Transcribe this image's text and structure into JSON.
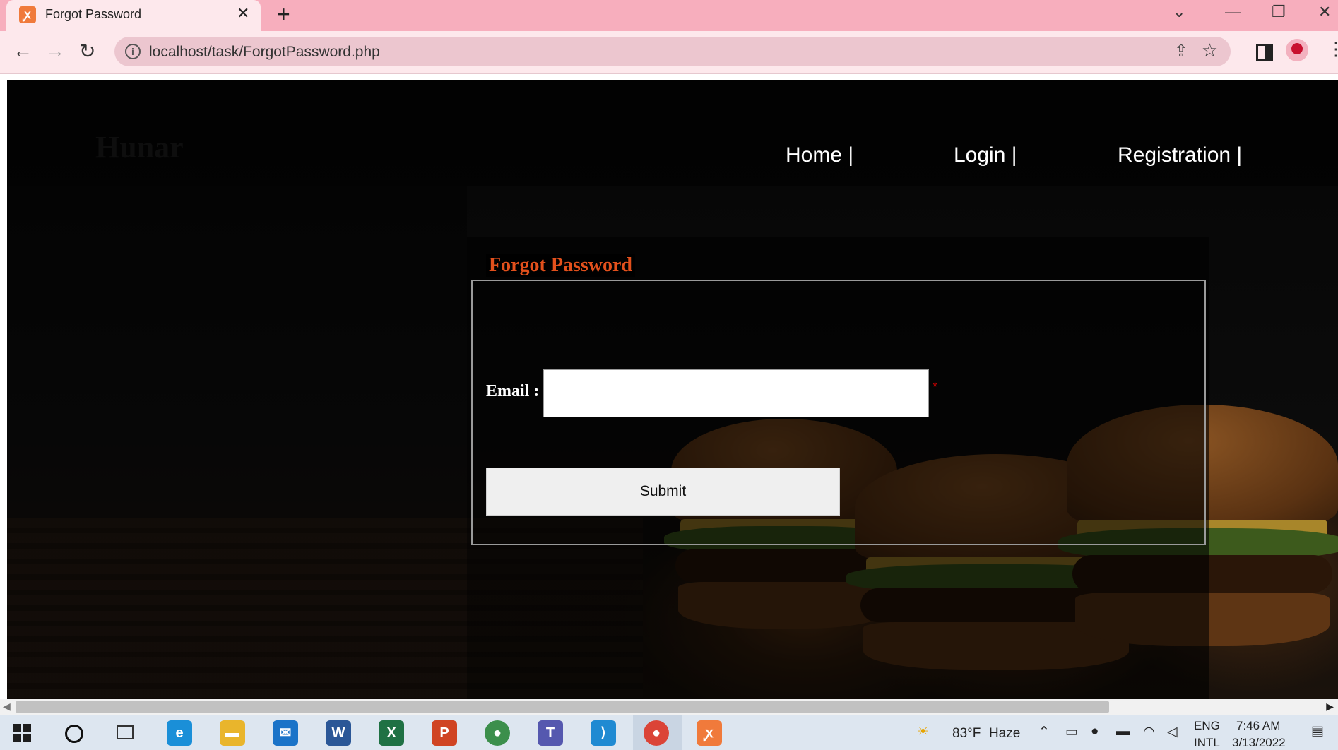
{
  "browser": {
    "tab_title": "Forgot Password",
    "tab_close": "✕",
    "new_tab": "+",
    "url": "localhost/task/ForgotPassword.php",
    "window_controls": {
      "minimize": "—",
      "restore": "❐",
      "close": "✕",
      "tab_search": "⌄"
    }
  },
  "site": {
    "brand": "Hunar",
    "nav": [
      {
        "label": "Home |"
      },
      {
        "label": "Login |"
      },
      {
        "label": "Registration |"
      }
    ]
  },
  "form": {
    "legend": "Forgot Password",
    "email_label": "Email :",
    "email_value": "",
    "required_mark": "*",
    "submit_label": "Submit"
  },
  "taskbar": {
    "apps": [
      {
        "name": "edge",
        "glyph": "e",
        "color": "#1a8fd8"
      },
      {
        "name": "file-explorer",
        "glyph": "▬",
        "color": "#e9b52c"
      },
      {
        "name": "mail",
        "glyph": "✉",
        "color": "#1a73c8"
      },
      {
        "name": "word",
        "glyph": "W",
        "color": "#2b5797"
      },
      {
        "name": "excel",
        "glyph": "X",
        "color": "#1f7144"
      },
      {
        "name": "powerpoint",
        "glyph": "P",
        "color": "#d04423"
      },
      {
        "name": "chrome",
        "glyph": "●",
        "color": "#3c8f4c"
      },
      {
        "name": "teams",
        "glyph": "T",
        "color": "#5558af"
      },
      {
        "name": "vscode",
        "glyph": "⟩",
        "color": "#1f8ad2"
      },
      {
        "name": "chrome-profile",
        "glyph": "●",
        "color": "#db4437"
      },
      {
        "name": "xampp",
        "glyph": "ꭙ",
        "color": "#f07a3b"
      }
    ],
    "weather_temp": "83°F",
    "weather_desc": "Haze",
    "language": "ENG",
    "language_sub": "INTL",
    "time": "7:46 AM",
    "date": "3/13/2022"
  }
}
